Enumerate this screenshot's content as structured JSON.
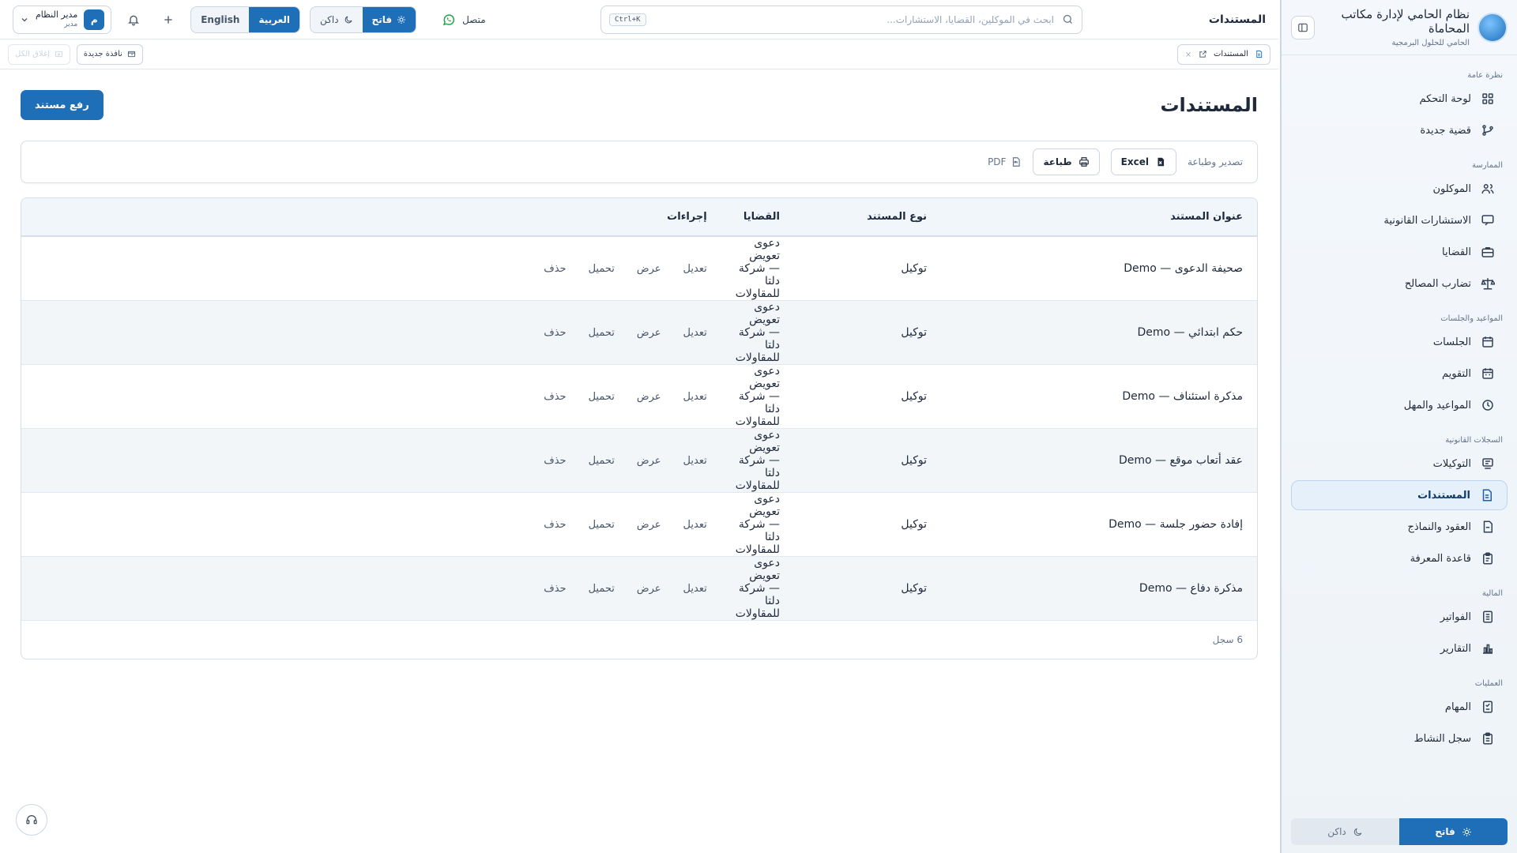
{
  "colors": {
    "primary": "#1f6fb8",
    "whatsapp": "#22a447"
  },
  "sidebar": {
    "brand_title": "نظام الحامي لإدارة مكاتب المحاماة",
    "brand_subtitle": "الحامي للحلول البرمجية",
    "sections": {
      "overview": "نظرة عامة",
      "practice": "الممارسة",
      "schedule": "المواعيد والجلسات",
      "records": "السجلات القانونية",
      "finance": "المالية",
      "ops": "العمليات"
    },
    "items": {
      "dashboard": "لوحة التحكم",
      "new_case": "قضية جديدة",
      "clients": "الموكلون",
      "consultations": "الاستشارات القانونية",
      "cases": "القضايا",
      "conflicts": "تضارب المصالح",
      "sessions": "الجلسات",
      "calendar": "التقويم",
      "deadlines": "المواعيد والمهل",
      "poa": "التوكيلات",
      "documents": "المستندات",
      "contracts": "العقود والنماذج",
      "knowledge": "قاعدة المعرفة",
      "invoices": "الفواتير",
      "reports": "التقارير",
      "tasks": "المهام",
      "activity": "سجل النشاط"
    },
    "theme_light": "فاتح",
    "theme_dark": "داكن"
  },
  "topbar": {
    "title": "المستندات",
    "search_placeholder": "ابحث في الموكلين، القضايا، الاستشارات...",
    "shortcut": "Ctrl+K",
    "status": "متصل",
    "theme_light": "فاتح",
    "theme_dark": "داكن",
    "lang_ar": "العربية",
    "lang_en": "English",
    "user_name": "مدير النظام",
    "user_role": "مدير",
    "avatar_letter": "م"
  },
  "tabsbar": {
    "active_tab": "المستندات",
    "new_window": "نافذة جديدة",
    "reset_all": "إغلاق الكل"
  },
  "page": {
    "title": "المستندات",
    "upload_button": "رفع مستند",
    "export_label": "تصدير وطباعة",
    "excel": "Excel",
    "print": "طباعة",
    "pdf": "PDF"
  },
  "table": {
    "headers": {
      "title": "عنوان المستند",
      "type": "نوع المستند",
      "cases": "القضايا",
      "actions": "إجراءات"
    },
    "action_labels": {
      "edit": "تعديل",
      "view": "عرض",
      "download": "تحميل",
      "delete": "حذف"
    },
    "rows": [
      {
        "title": "صحيفة الدعوى — Demo",
        "type": "توكيل",
        "case": "دعوى تعويض — شركة دلتا للمقاولات"
      },
      {
        "title": "حكم ابتدائي — Demo",
        "type": "توكيل",
        "case": "دعوى تعويض — شركة دلتا للمقاولات"
      },
      {
        "title": "مذكرة استئناف — Demo",
        "type": "توكيل",
        "case": "دعوى تعويض — شركة دلتا للمقاولات"
      },
      {
        "title": "عقد أتعاب موقع — Demo",
        "type": "توكيل",
        "case": "دعوى تعويض — شركة دلتا للمقاولات"
      },
      {
        "title": "إفادة حضور جلسة — Demo",
        "type": "توكيل",
        "case": "دعوى تعويض — شركة دلتا للمقاولات"
      },
      {
        "title": "مذكرة دفاع — Demo",
        "type": "توكيل",
        "case": "دعوى تعويض — شركة دلتا للمقاولات"
      }
    ],
    "footer": "6 سجل"
  }
}
